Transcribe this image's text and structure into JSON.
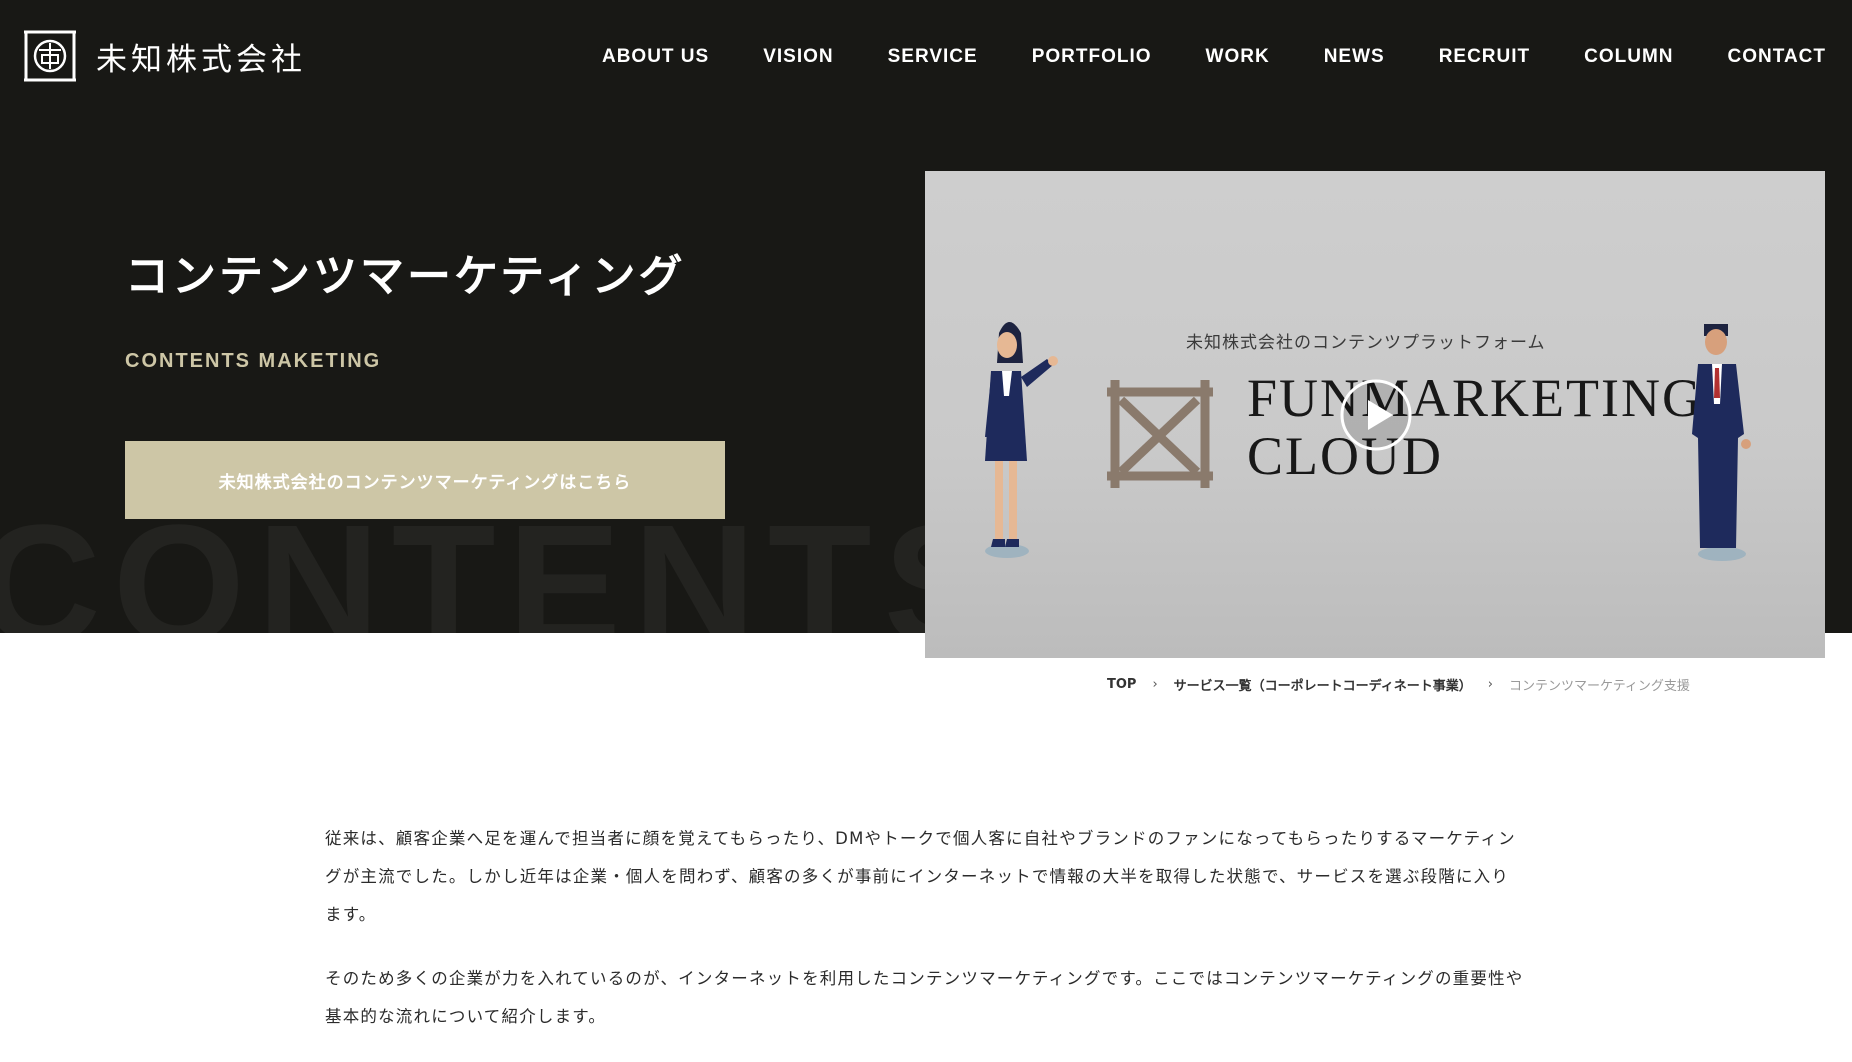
{
  "header": {
    "company_name": "未知株式会社",
    "nav": [
      "ABOUT US",
      "VISION",
      "SERVICE",
      "PORTFOLIO",
      "WORK",
      "NEWS",
      "RECRUIT",
      "COLUMN",
      "CONTACT"
    ]
  },
  "hero": {
    "title": "コンテンツマーケティング",
    "subtitle": "CONTENTS MAKETING",
    "cta_label": "未知株式会社のコンテンツマーケティングはこちら",
    "background_word": "CONTENTS"
  },
  "video": {
    "caption": "未知株式会社のコンテンツプラットフォーム",
    "title_line1": "FUNMARKETING",
    "title_line2": "CLOUD"
  },
  "breadcrumb": {
    "items": [
      "TOP",
      "サービス一覧（コーポレートコーディネート事業）",
      "コンテンツマーケティング支援"
    ],
    "separator": "›"
  },
  "content": {
    "paragraphs": [
      "従来は、顧客企業へ足を運んで担当者に顔を覚えてもらったり、DMやトークで個人客に自社やブランドのファンになってもらったりするマーケティングが主流でした。しかし近年は企業・個人を問わず、顧客の多くが事前にインターネットで情報の大半を取得した状態で、サービスを選ぶ段階に入ります。",
      "そのため多くの企業が力を入れているのが、インターネットを利用したコンテンツマーケティングです。ここではコンテンツマーケティングの重要性や基本的な流れについて紹介します。"
    ]
  },
  "colors": {
    "hero_background": "#181815",
    "accent_beige": "#cdc6a6",
    "logo_brown": "#8a7a6c"
  },
  "icons": {
    "company_logo": "company-logo-icon",
    "play": "play-icon",
    "video_logo": "funmarketing-logo-icon"
  }
}
